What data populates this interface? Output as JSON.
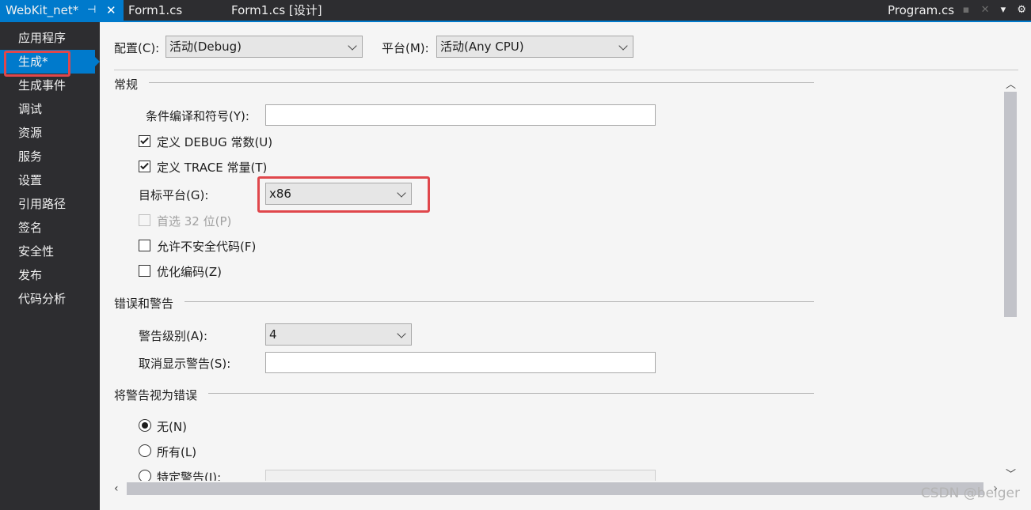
{
  "tabs": {
    "active": "WebKit_net*",
    "pin_icon": "pin-icon",
    "close_icon": "close-icon",
    "t2": "Form1.cs",
    "t3": "Form1.cs [设计]",
    "t4": "Program.cs"
  },
  "nav": {
    "items": [
      "应用程序",
      "生成*",
      "生成事件",
      "调试",
      "资源",
      "服务",
      "设置",
      "引用路径",
      "签名",
      "安全性",
      "发布",
      "代码分析"
    ],
    "selected_index": 1
  },
  "config": {
    "config_label": "配置(C):",
    "config_value": "活动(Debug)",
    "platform_label": "平台(M):",
    "platform_value": "活动(Any CPU)"
  },
  "general": {
    "title": "常规",
    "conditional_label": "条件编译和符号(Y):",
    "conditional_value": "",
    "define_debug": "定义 DEBUG 常数(U)",
    "define_debug_checked": true,
    "define_trace": "定义 TRACE 常量(T)",
    "define_trace_checked": true,
    "target_label": "目标平台(G):",
    "target_value": "x86",
    "prefer32": "首选 32 位(P)",
    "prefer32_checked": false,
    "unsafe": "允许不安全代码(F)",
    "unsafe_checked": false,
    "optimize": "优化编码(Z)",
    "optimize_checked": false
  },
  "errors": {
    "title": "错误和警告",
    "warning_level_label": "警告级别(A):",
    "warning_level_value": "4",
    "suppress_label": "取消显示警告(S):",
    "suppress_value": ""
  },
  "treat": {
    "title": "将警告视为错误",
    "none": "无(N)",
    "all": "所有(L)",
    "specific": "特定警告(I):",
    "selected": "none"
  },
  "watermark": "CSDN @beiger",
  "colors": {
    "accent": "#007acc",
    "highlight_box": "#e0474c"
  }
}
